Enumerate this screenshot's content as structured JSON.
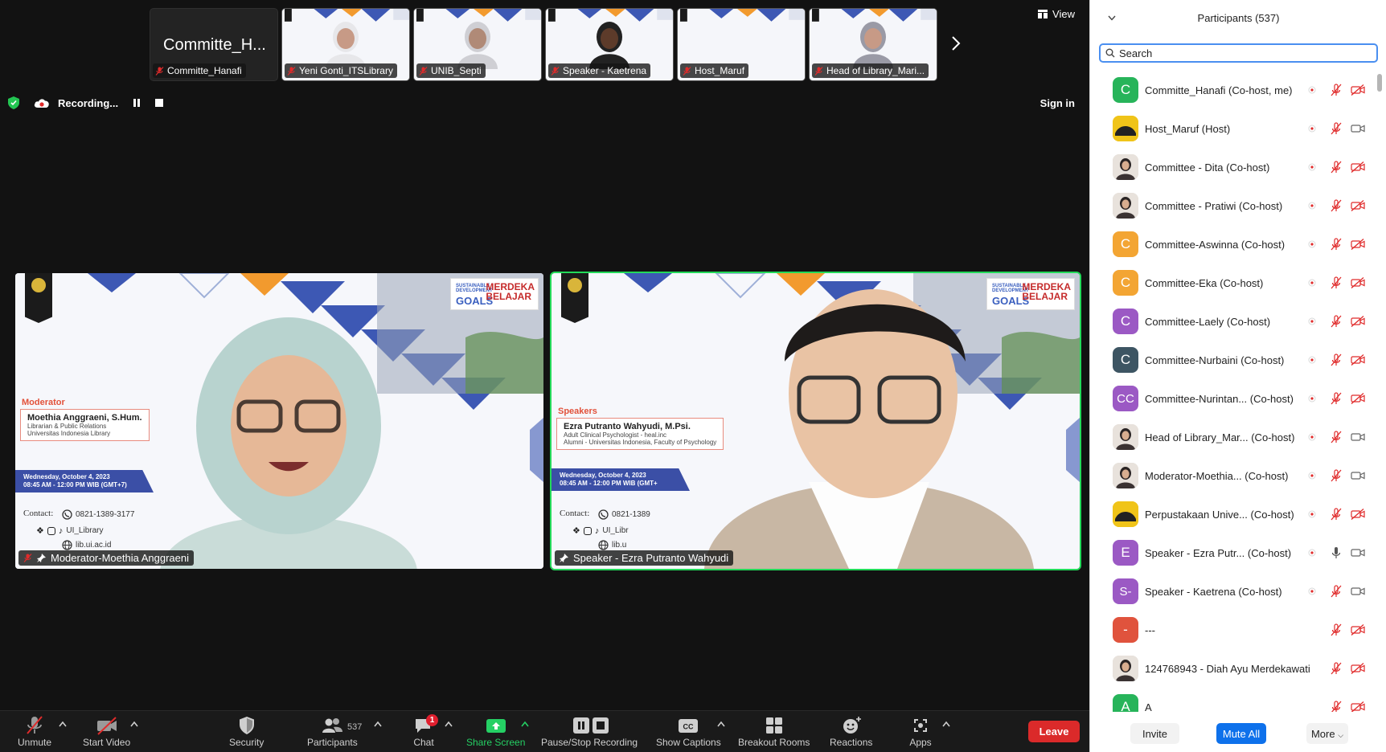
{
  "window": {
    "view_label": "View",
    "sign_in_label": "Sign in"
  },
  "gallery": {
    "thumbnails": [
      {
        "big_name": "Committe_H...",
        "label": "Committe_Hanafi",
        "video": false
      },
      {
        "label": "Yeni Gonti_ITSLibrary",
        "video": true,
        "tone": "#c79a86",
        "scarf": "#e7e7ea"
      },
      {
        "label": "UNIB_Septi",
        "video": true,
        "tone": "#b08a77",
        "scarf": "#cfcfd4"
      },
      {
        "label": "Speaker - Kaetrena",
        "video": true,
        "tone": "#5d3b2a",
        "scarf": "#222222"
      },
      {
        "label": "Host_Maruf",
        "video": true,
        "empty": true
      },
      {
        "label": "Head of Library_Mari...",
        "video": true,
        "tone": "#c79a86",
        "scarf": "#9a9aa6"
      }
    ]
  },
  "recording": {
    "label": "Recording..."
  },
  "tiles": [
    {
      "name": "Moderator-Moethia Anggraeni",
      "role": "Moderator",
      "card_name": "Moethia Anggraeni, S.Hum.",
      "card_sub1": "Librarian & Public Relations",
      "card_sub2": "Universitas Indonesia Library",
      "date1": "Wednesday, October 4, 2023",
      "date2": "08:45 AM - 12:00 PM WIB (GMT+7)",
      "contact_label": "Contact:",
      "phone": "0821-1389-3177",
      "social": "UI_Library",
      "web": "lib.ui.ac.id",
      "sdg_a": "SUSTAINABLE DEVELOPMENT",
      "sdg_b": "GOALS",
      "sdg_c1": "MERDEKA",
      "sdg_c2": "BELAJAR",
      "active": false
    },
    {
      "name": "Speaker - Ezra Putranto Wahyudi",
      "role": "Speakers",
      "card_name": "Ezra Putranto Wahyudi, M.Psi.",
      "card_sub1": "Adult Clinical Psychologist - heal.inc",
      "card_sub2": "Alumni - Universitas Indonesia, Faculty of Psychology",
      "date1": "Wednesday, October 4, 2023",
      "date2": "08:45 AM - 12:00 PM WIB (GMT+",
      "contact_label": "Contact:",
      "phone": "0821-1389",
      "social": "UI_Libr",
      "web": "lib.u",
      "sdg_a": "SUSTAINABLE DEVELOPMENT",
      "sdg_b": "GOALS",
      "sdg_c1": "MERDEKA",
      "sdg_c2": "BELAJAR",
      "active": true
    }
  ],
  "toolbar": {
    "unmute": "Unmute",
    "start_video": "Start Video",
    "security": "Security",
    "participants": "Participants",
    "participants_count": "537",
    "chat": "Chat",
    "chat_badge": "1",
    "share_screen": "Share Screen",
    "pause_stop": "Pause/Stop Recording",
    "captions": "Show Captions",
    "breakout": "Breakout Rooms",
    "reactions": "Reactions",
    "apps": "Apps",
    "leave": "Leave"
  },
  "participants_panel": {
    "title": "Participants (537)",
    "search_placeholder": "Search",
    "invite": "Invite",
    "mute_all": "Mute All",
    "more": "More",
    "items": [
      {
        "name": "Committe_Hanafi (Co-host, me)",
        "initials": "C",
        "color": "#27b45a",
        "cam": "off"
      },
      {
        "name": "Host_Maruf (Host)",
        "initials": "",
        "color": "#f0c419",
        "cam": "on",
        "photo": "logo"
      },
      {
        "name": "Committee - Dita (Co-host)",
        "initials": "",
        "color": "#d9d3cc",
        "cam": "off",
        "photo": "person"
      },
      {
        "name": "Committee - Pratiwi (Co-host)",
        "initials": "",
        "color": "#d9d3cc",
        "cam": "off",
        "photo": "person"
      },
      {
        "name": "Committee-Aswinna (Co-host)",
        "initials": "C",
        "color": "#f3a533",
        "cam": "off"
      },
      {
        "name": "Committee-Eka (Co-host)",
        "initials": "C",
        "color": "#f3a533",
        "cam": "off"
      },
      {
        "name": "Committee-Laely (Co-host)",
        "initials": "C",
        "color": "#9b59c4",
        "cam": "off"
      },
      {
        "name": "Committee-Nurbaini (Co-host)",
        "initials": "C",
        "color": "#3d5563",
        "cam": "off"
      },
      {
        "name": "Committee-Nurintan... (Co-host)",
        "initials": "CC",
        "color": "#9b59c4",
        "cam": "off"
      },
      {
        "name": "Head of Library_Mar...  (Co-host)",
        "initials": "",
        "color": "#d9d3cc",
        "cam": "on",
        "photo": "person"
      },
      {
        "name": "Moderator-Moethia...  (Co-host)",
        "initials": "",
        "color": "#d9d3cc",
        "cam": "on",
        "photo": "person"
      },
      {
        "name": "Perpustakaan Unive...  (Co-host)",
        "initials": "",
        "color": "#f0c419",
        "cam": "off",
        "photo": "logo"
      },
      {
        "name": "Speaker - Ezra Putr...  (Co-host)",
        "initials": "E",
        "color": "#9b59c4",
        "cam": "on",
        "mic": "on"
      },
      {
        "name": "Speaker - Kaetrena (Co-host)",
        "initials": "S-",
        "color": "#9b59c4",
        "cam": "on"
      },
      {
        "name": "---",
        "initials": "-",
        "color": "#e0533d",
        "cam": "off",
        "norec": true
      },
      {
        "name": "124768943 - Diah Ayu Merdekawati",
        "initials": "",
        "color": "#d9d3cc",
        "cam": "off",
        "photo": "person",
        "norec": true
      },
      {
        "name": "A",
        "initials": "A",
        "color": "#27b45a",
        "cam": "off",
        "norec": true
      }
    ]
  }
}
